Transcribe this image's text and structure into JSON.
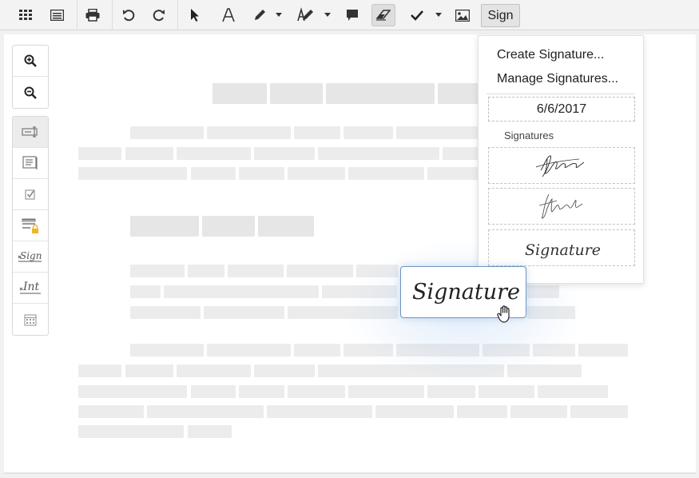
{
  "toolbar": {
    "sign_label": "Sign",
    "icons": [
      "grid-icon",
      "panel-icon",
      "print-icon",
      "undo-icon",
      "redo-icon",
      "select-arrow-icon",
      "text-icon",
      "pen-icon",
      "highlighter-icon",
      "comment-icon",
      "eraser-icon",
      "checkmark-icon",
      "image-icon"
    ]
  },
  "left_panel": {
    "zoom": [
      "zoom-in-icon",
      "zoom-out-icon"
    ],
    "tools": [
      "text-field-icon",
      "form-field-icon",
      "checkbox-icon",
      "locked-field-icon",
      "signature-field-icon",
      "initials-field-icon",
      "date-field-icon"
    ],
    "sign_glyph": "Sign",
    "initials_glyph": "Int"
  },
  "sign_menu": {
    "create": "Create Signature...",
    "manage": "Manage Signatures...",
    "date": "6/6/2017",
    "section": "Signatures",
    "signature_text": "Signature"
  },
  "dragged_signature": {
    "text": "Signature"
  },
  "colors": {
    "toolbar_bg": "#f3f3f3",
    "drag_border": "#6f93c0"
  }
}
